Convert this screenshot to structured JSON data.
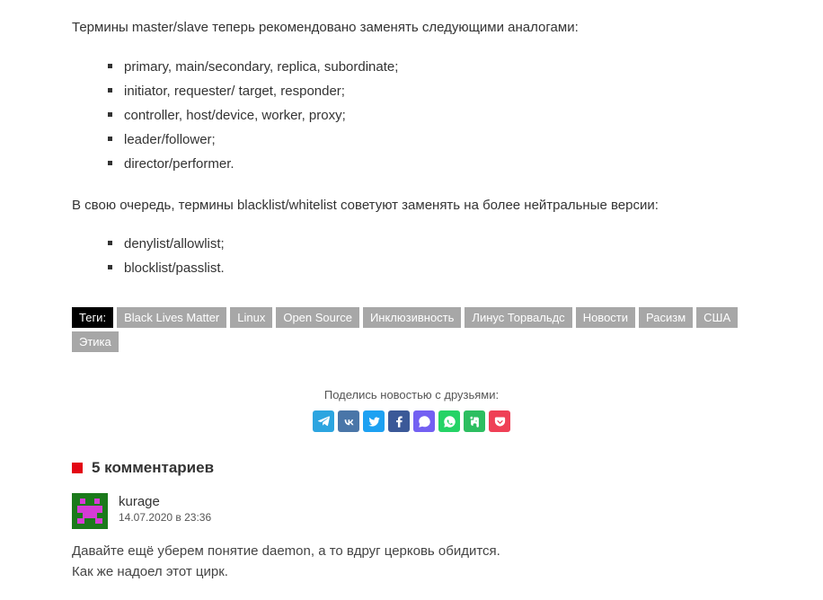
{
  "article": {
    "intro1": "Термины master/slave теперь рекомендовано заменять следующими аналогами:",
    "list1": [
      "primary, main/secondary, replica, subordinate;",
      "initiator, requester/ target, responder;",
      "controller, host/device, worker, proxy;",
      "leader/follower;",
      "director/performer."
    ],
    "intro2": "В свою очередь, термины blacklist/whitelist советуют заменять на более нейтральные версии:",
    "list2": [
      "denylist/allowlist;",
      "blocklist/passlist."
    ]
  },
  "tags": {
    "label": "Теги:",
    "items": [
      "Black Lives Matter",
      "Linux",
      "Open Source",
      "Инклюзивность",
      "Линус Торвальдс",
      "Новости",
      "Расизм",
      "США",
      "Этика"
    ]
  },
  "share": {
    "text": "Поделись новостью с друзьями:"
  },
  "comments": {
    "title": "5 комментариев",
    "items": [
      {
        "author": "kurage",
        "date": "14.07.2020 в 23:36",
        "text": "Давайте ещё уберем понятие daemon, а то вдруг церковь обидится.\nКак же надоел этот цирк."
      }
    ]
  }
}
